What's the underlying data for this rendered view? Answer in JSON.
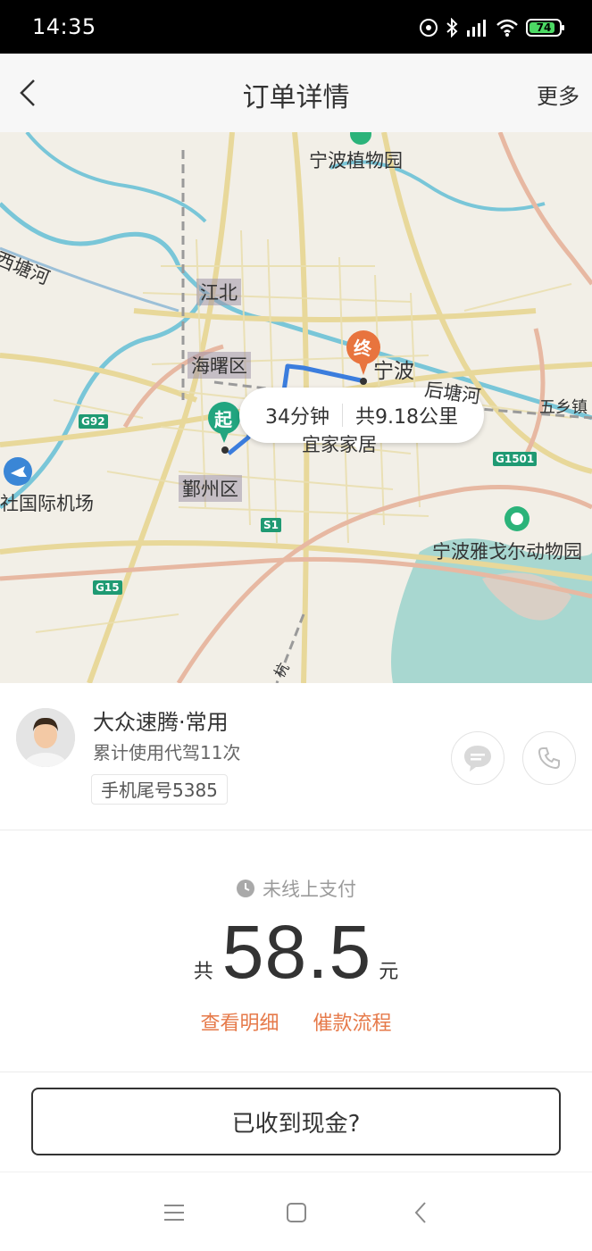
{
  "status_bar": {
    "time": "14:35",
    "battery": "74"
  },
  "header": {
    "title": "订单详情",
    "more_label": "更多"
  },
  "map": {
    "bubble": {
      "duration": "34分钟",
      "distance": "共9.18公里"
    },
    "start_marker": "起",
    "end_marker": "终",
    "labels": {
      "botanical_garden": "宁波植物园",
      "xitang_river": "西塘河",
      "jiangbei": "江北",
      "haishu": "海曙区",
      "ningbo": "宁波",
      "houtang_river": "后塘河",
      "wuxiang": "五乡镇",
      "ikea": "宜家家居",
      "airport": "社国际机场",
      "yinzhou": "鄞州区",
      "zoo": "宁波雅戈尔动物园",
      "hang": "杭"
    },
    "road_badges": {
      "g92": "G92",
      "g1501": "G1501",
      "s1": "S1",
      "g15": "G15"
    }
  },
  "driver": {
    "name": "大众速腾·常用",
    "usage": "累计使用代驾11次",
    "phone_tail": "手机尾号5385"
  },
  "payment": {
    "status": "未线上支付",
    "prefix": "共",
    "amount": "58.5",
    "unit": "元",
    "detail_link": "查看明细",
    "collect_link": "催款流程"
  },
  "cash_button": "已收到现金?",
  "colors": {
    "accent": "#e67a4a",
    "route": "#3b7ddd",
    "start": "#22a57f",
    "end": "#e8743e"
  }
}
